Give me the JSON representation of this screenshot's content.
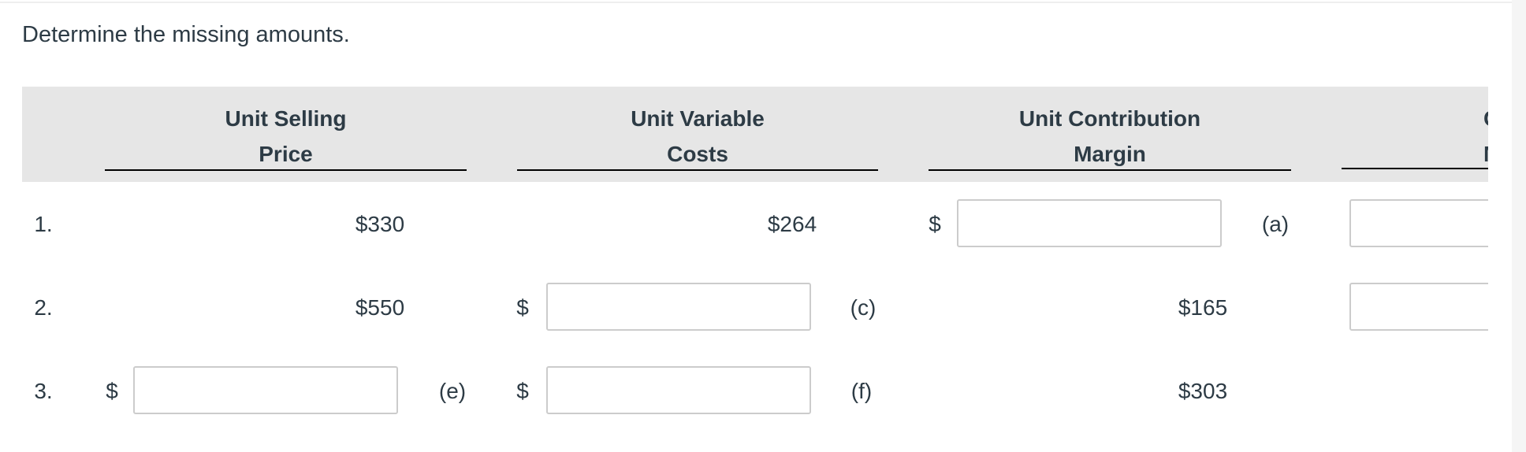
{
  "title": "Determine the missing amounts.",
  "headers": [
    {
      "line1": "Unit Selling",
      "line2": "Price"
    },
    {
      "line1": "Unit Variable",
      "line2": "Costs"
    },
    {
      "line1": "Unit Contribution",
      "line2": "Margin"
    },
    {
      "line1": "Co",
      "line2": "M"
    }
  ],
  "rows": [
    {
      "num": "1.",
      "price": "$330",
      "variable": "$264",
      "margin_currency": "$",
      "margin_label": "(a)"
    },
    {
      "num": "2.",
      "price": "$550",
      "variable_currency": "$",
      "variable_label": "(c)",
      "margin": "$165"
    },
    {
      "num": "3.",
      "price_currency": "$",
      "price_label": "(e)",
      "variable_currency": "$",
      "variable_label": "(f)",
      "margin": "$303"
    }
  ]
}
